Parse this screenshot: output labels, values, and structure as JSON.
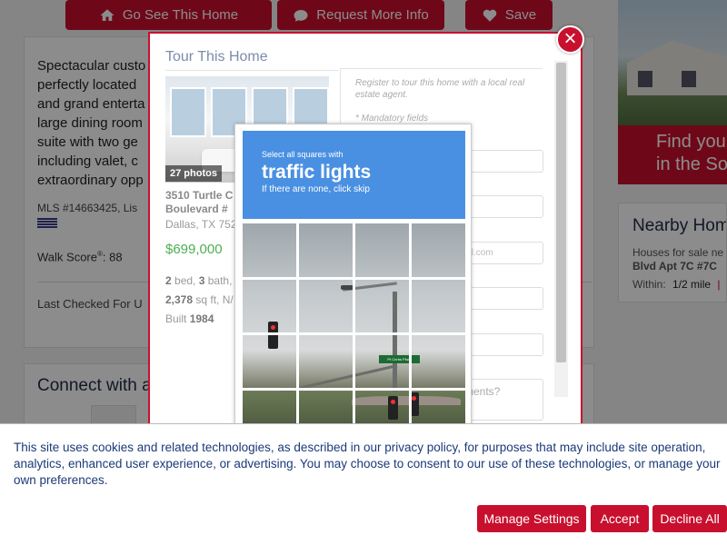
{
  "listing_actions": {
    "go_see": "Go See This Home",
    "request_info": "Request More Info",
    "save": "Save"
  },
  "listing": {
    "description": [
      "Spectacular custo",
      "perfectly located",
      "and grand enterta",
      "large dining room",
      "suite with two ge",
      "including valet, c",
      "extraordinary opp"
    ],
    "mls": "MLS #14663425, Lis",
    "walk_score_label": "Walk Score",
    "walk_score_sup": "®",
    "walk_score_value": ": 88",
    "last_checked": "Last Checked For U",
    "connect": "Connect with a"
  },
  "ad": {
    "line1": "Find you",
    "line2": "in the So"
  },
  "nearby": {
    "title": "Nearby Hom",
    "text1": "Houses for sale ne",
    "text2": "Blvd Apt 7C #7C",
    "within_label": "Within:",
    "within_value": "1/2 mile"
  },
  "modal": {
    "title": "Tour This Home",
    "close": "×",
    "photo_count": "27 photos",
    "address_line1": "3510 Turtle C",
    "address_line2": "Boulevard #",
    "city": "Dallas, TX 752",
    "price": "$699,000",
    "beds": "2",
    "beds_label": " bed, ",
    "baths": "3",
    "baths_label": " bath,",
    "sqft": "2,378",
    "sqft_label": " sq ft, N/",
    "built_label": "Built ",
    "built_year": "1984",
    "register_text": "Register to tour this home with a local real estate agent.",
    "mandatory": "* Mandatory fields",
    "email_placeholder": "ail.com",
    "comments_placeholder": "ments?"
  },
  "captcha": {
    "instruction_small": "Select all squares with",
    "target": "traffic lights",
    "hint": "If there are none, click skip",
    "sign_text": "Pt Cnrbs Pkwy"
  },
  "cookie_banner": {
    "text": "This site uses cookies and related technologies, as described in our privacy policy, for purposes that may include site operation, analytics, enhanced user experience, or advertising. You may choose to consent to our use of these technologies, or manage your own preferences.",
    "manage": "Manage Settings",
    "accept": "Accept",
    "decline": "Decline All"
  },
  "colors": {
    "brand_red": "#c8102e",
    "captcha_blue": "#4a90e2",
    "price_green": "#4caf50",
    "cookie_text": "#1a3a7a"
  }
}
